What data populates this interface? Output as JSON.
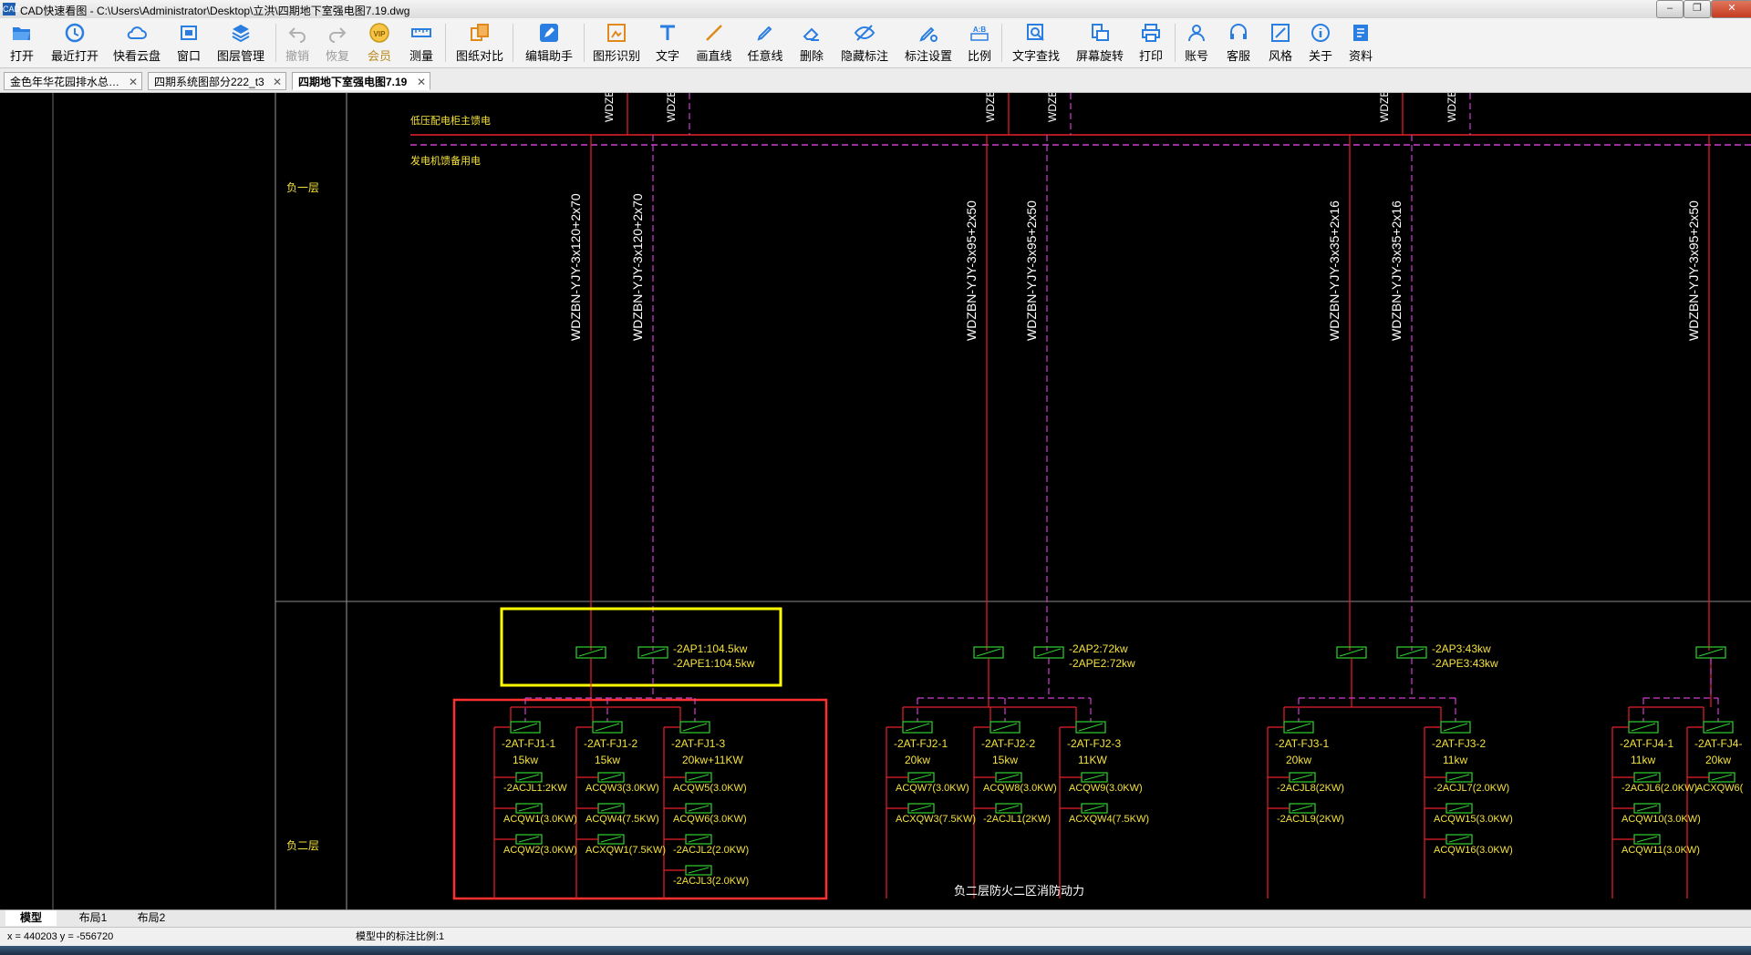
{
  "window": {
    "title": "CAD快速看图 - C:\\Users\\Administrator\\Desktop\\立洪\\四期地下室强电图7.19.dwg",
    "app_icon_text": "CAD"
  },
  "toolbar": [
    {
      "label": "打开",
      "icon": "open-folder-icon"
    },
    {
      "label": "最近打开",
      "icon": "recent-clock-icon"
    },
    {
      "label": "快看云盘",
      "icon": "cloud-icon"
    },
    {
      "label": "窗口",
      "icon": "window-icon"
    },
    {
      "label": "图层管理",
      "icon": "layers-icon"
    },
    {
      "label": "撤销",
      "icon": "undo-icon"
    },
    {
      "label": "恢复",
      "icon": "redo-icon"
    },
    {
      "label": "会员",
      "icon": "vip-icon"
    },
    {
      "label": "测量",
      "icon": "ruler-icon"
    },
    {
      "label": "图纸对比",
      "icon": "compare-icon"
    },
    {
      "label": "编辑助手",
      "icon": "edit-assistant-icon"
    },
    {
      "label": "图形识别",
      "icon": "shape-recognition-icon"
    },
    {
      "label": "文字",
      "icon": "text-icon"
    },
    {
      "label": "画直线",
      "icon": "line-icon"
    },
    {
      "label": "任意线",
      "icon": "freehand-pen-icon"
    },
    {
      "label": "删除",
      "icon": "eraser-icon"
    },
    {
      "label": "隐藏标注",
      "icon": "hide-eye-icon"
    },
    {
      "label": "标注设置",
      "icon": "annotation-settings-icon"
    },
    {
      "label": "比例",
      "icon": "scale-icon"
    },
    {
      "label": "文字查找",
      "icon": "text-search-icon"
    },
    {
      "label": "屏幕旋转",
      "icon": "screen-rotate-icon"
    },
    {
      "label": "打印",
      "icon": "printer-icon"
    },
    {
      "label": "账号",
      "icon": "user-icon"
    },
    {
      "label": "客服",
      "icon": "headset-icon"
    },
    {
      "label": "风格",
      "icon": "style-icon"
    },
    {
      "label": "关于",
      "icon": "info-icon"
    },
    {
      "label": "资料",
      "icon": "materials-icon"
    }
  ],
  "tabs": [
    {
      "label": "金色年华花园排水总…",
      "active": false
    },
    {
      "label": "四期系统图部分222_t3",
      "active": false
    },
    {
      "label": "四期地下室强电图7.19",
      "active": true
    }
  ],
  "drawing": {
    "bus_label_1": "低压配电柜主馈电",
    "bus_label_2": "发电机馈备用电",
    "floor_label_b1": "负一层",
    "floor_label_b2": "负二层",
    "top_tags": [
      "WDZB",
      "WDZB",
      "WDZB",
      "WDZB",
      "WDZB",
      "WDZB"
    ],
    "cables": [
      "WDZBN-YJY-3x120+2x70",
      "WDZBN-YJY-3x120+2x70",
      "WDZBN-YJY-3x95+2x50",
      "WDZBN-YJY-3x95+2x50",
      "WDZBN-YJY-3x35+2x16",
      "WDZBN-YJY-3x35+2x16",
      "WDZBN-YJY-3x95+2x50"
    ],
    "panels": [
      {
        "main": "-2AP1:104.5kw",
        "backup": "-2APE1:104.5kw"
      },
      {
        "main": "-2AP2:72kw",
        "backup": "-2APE2:72kw"
      },
      {
        "main": "-2AP3:43kw",
        "backup": "-2APE3:43kw"
      }
    ],
    "subpanels": [
      {
        "name": "-2AT-FJ1-1",
        "power": "15kw",
        "loads": [
          "-2ACJL1:2KW",
          "ACQW1(3.0KW)",
          "ACQW2(3.0KW)"
        ]
      },
      {
        "name": "-2AT-FJ1-2",
        "power": "15kw",
        "loads": [
          "ACQW3(3.0KW)",
          "ACQW4(7.5KW)",
          "ACXQW1(7.5KW)"
        ]
      },
      {
        "name": "-2AT-FJ1-3",
        "power": "20kw+11KW",
        "loads": [
          "ACQW5(3.0KW)",
          "ACQW6(3.0KW)",
          "-2ACJL2(2.0KW)",
          "-2ACJL3(2.0KW)"
        ]
      },
      {
        "name": "-2AT-FJ2-1",
        "power": "20kw",
        "loads": [
          "ACQW7(3.0KW)",
          "ACXQW3(7.5KW)"
        ]
      },
      {
        "name": "-2AT-FJ2-2",
        "power": "15kw",
        "loads": [
          "ACQW8(3.0KW)",
          "-2ACJL1(2KW)"
        ]
      },
      {
        "name": "-2AT-FJ2-3",
        "power": "11KW",
        "loads": [
          "ACQW9(3.0KW)",
          "ACXQW4(7.5KW)"
        ]
      },
      {
        "name": "-2AT-FJ3-1",
        "power": "20kw",
        "loads": [
          "-2ACJL8(2KW)",
          "-2ACJL9(2KW)"
        ]
      },
      {
        "name": "-2AT-FJ3-2",
        "power": "11kw",
        "loads": [
          "-2ACJL7(2.0KW)",
          "ACQW15(3.0KW)",
          "ACQW16(3.0KW)"
        ]
      },
      {
        "name": "-2AT-FJ4-1",
        "power": "11kw",
        "loads": [
          "-2ACJL6(2.0KW)",
          "ACQW10(3.0KW)",
          "ACQW11(3.0KW)"
        ]
      },
      {
        "name": "-2AT-FJ4-",
        "power": "20kw",
        "loads": [
          "ACXQW6("
        ]
      }
    ],
    "section_title": "负二层防火二区消防动力"
  },
  "layout_tabs": [
    {
      "label": "模型",
      "active": true
    },
    {
      "label": "布局1",
      "active": false
    },
    {
      "label": "布局2",
      "active": false
    }
  ],
  "status": {
    "coords": "x = 440203  y = -556720",
    "scale_text": "模型中的标注比例:1"
  },
  "colors": {
    "canvas_bg": "#000000",
    "red_line": "#e8202a",
    "magenta_line": "#d03cd0",
    "text_yellow": "#f5e23c",
    "text_white": "#ffffff",
    "green_breaker": "#2fd12f",
    "highlight_yellow": "#ffff00",
    "highlight_red": "#ff3030",
    "tool_blue": "#2a7de1"
  }
}
